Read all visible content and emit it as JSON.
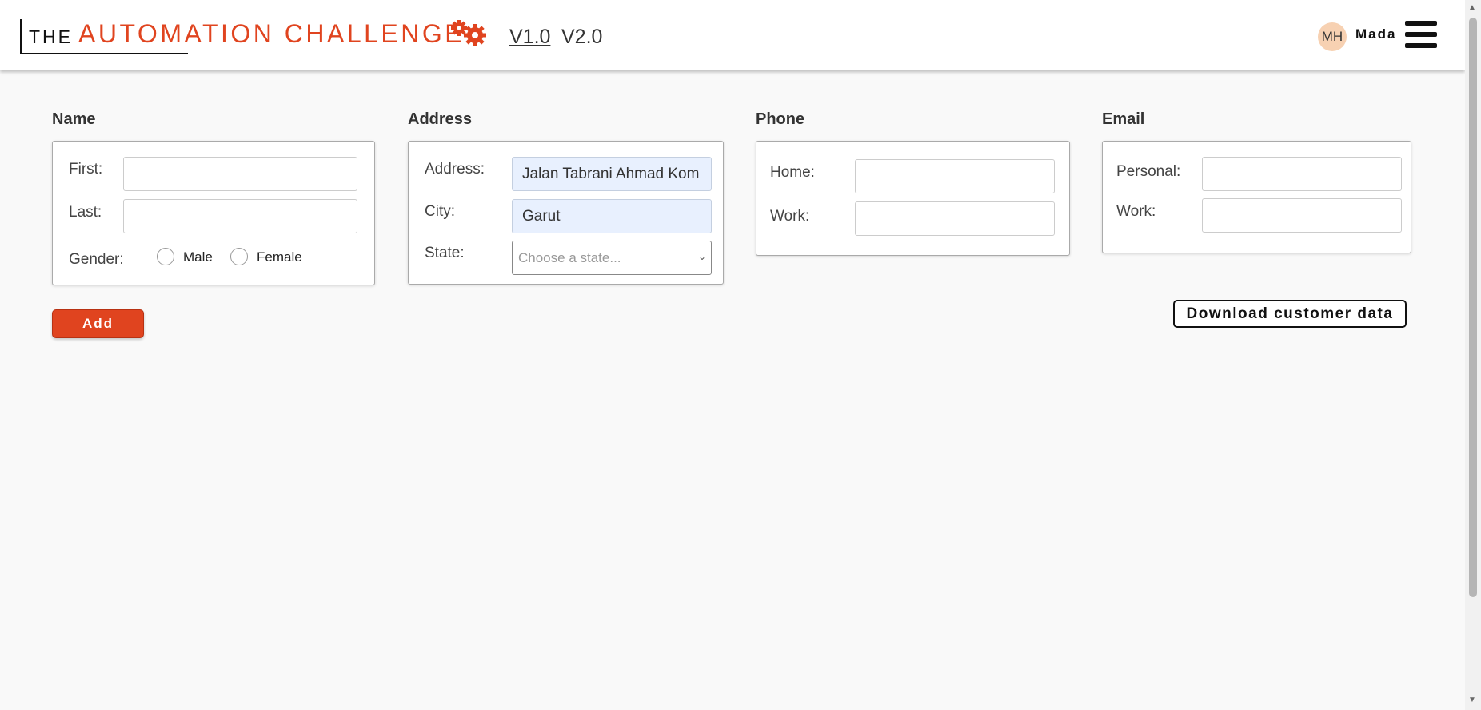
{
  "header": {
    "logo_the": "THE",
    "logo_main": "AUTOMATION CHALLENGE",
    "version_1": "V1.0",
    "version_2": "V2.0",
    "avatar_initials": "MH",
    "username": "Mada",
    "menu_icon": "hamburger-menu-icon",
    "logo_icon": "gears-icon"
  },
  "name_section": {
    "title": "Name",
    "first_label": "First:",
    "first_value": "",
    "last_label": "Last:",
    "last_value": "",
    "gender_label": "Gender:",
    "male_label": "Male",
    "female_label": "Female"
  },
  "address_section": {
    "title": "Address",
    "address_label": "Address:",
    "address_value": "Jalan Tabrani Ahmad Kom",
    "city_label": "City:",
    "city_value": "Garut",
    "state_label": "State:",
    "state_placeholder": "Choose a state..."
  },
  "phone_section": {
    "title": "Phone",
    "home_label": "Home:",
    "home_value": "",
    "work_label": "Work:",
    "work_value": ""
  },
  "email_section": {
    "title": "Email",
    "personal_label": "Personal:",
    "personal_value": "",
    "work_label": "Work:",
    "work_value": ""
  },
  "actions": {
    "add_label": "Add",
    "download_label": "Download customer data"
  },
  "colors": {
    "accent": "#e0441f",
    "autofill": "#e8f0fe",
    "avatar": "#f7d1b2"
  }
}
